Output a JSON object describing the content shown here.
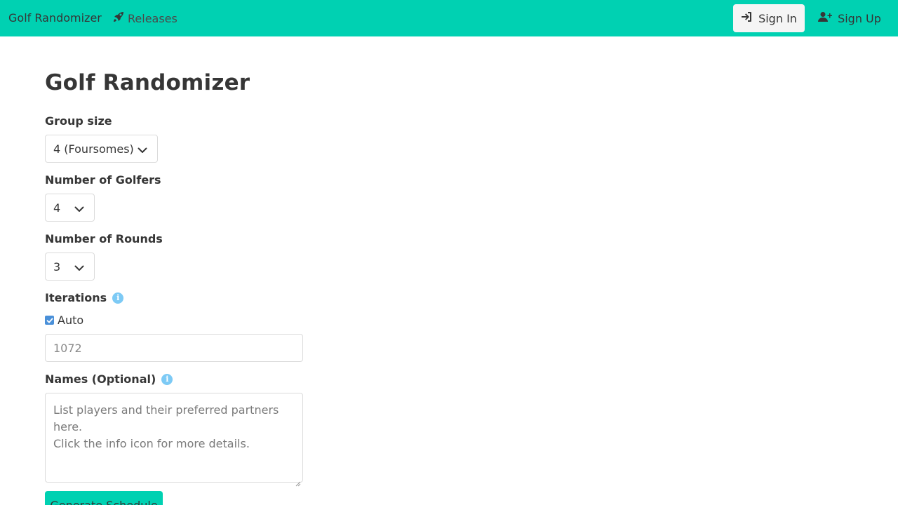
{
  "navbar": {
    "brand": "Golf Randomizer",
    "releases_label": "Releases",
    "sign_in_label": "Sign In",
    "sign_up_label": "Sign Up"
  },
  "page": {
    "title": "Golf Randomizer"
  },
  "form": {
    "group_size": {
      "label": "Group size",
      "value": "4 (Foursomes)"
    },
    "num_golfers": {
      "label": "Number of Golfers",
      "value": "4"
    },
    "num_rounds": {
      "label": "Number of Rounds",
      "value": "3"
    },
    "iterations": {
      "label": "Iterations",
      "auto_label": "Auto",
      "auto_checked": true,
      "value": "1072"
    },
    "names": {
      "label": "Names (Optional)",
      "placeholder": "List players and their preferred partners here.\nClick the info icon for more details."
    },
    "generate_label": "Generate Schedule"
  },
  "colors": {
    "primary": "#00d1b2",
    "info": "#7dcaf5",
    "text": "#363636"
  }
}
